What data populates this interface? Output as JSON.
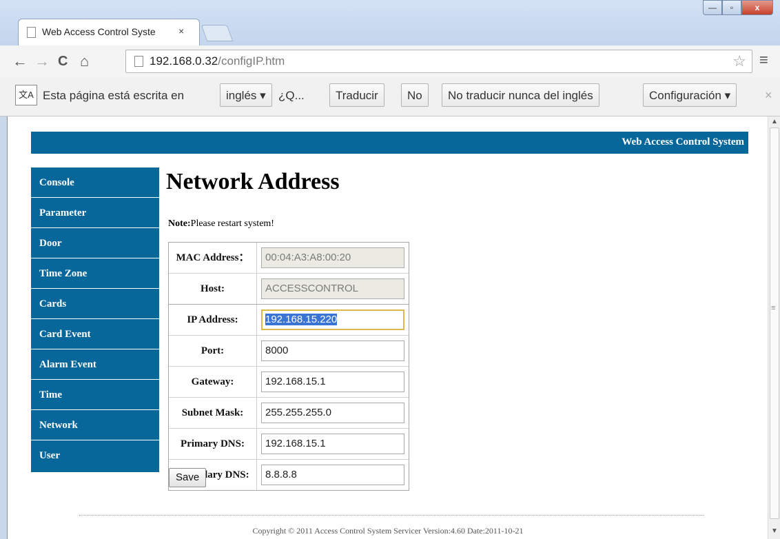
{
  "browser": {
    "tab_title": "Web Access Control Syste",
    "tab_close": "×",
    "window_controls": {
      "minimize": "—",
      "maximize": "▫",
      "close": "x"
    },
    "url_host": "192.168.0.32",
    "url_path": "/configIP.htm",
    "nav": {
      "back": "←",
      "forward": "→",
      "reload": "C",
      "home": "⌂"
    }
  },
  "translate_bar": {
    "icon_text": "文A",
    "text_prefix": "Esta página está escrita en",
    "language": "inglés ▾",
    "question": "¿Q...",
    "translate_button": "Traducir",
    "no_button": "No",
    "never_button": "No traducir nunca del inglés",
    "settings_button": "Configuración ▾",
    "close": "×"
  },
  "page": {
    "banner_title": "Web Access Control System",
    "sidebar": {
      "items": [
        {
          "label": "Console"
        },
        {
          "label": "Parameter"
        },
        {
          "label": "Door"
        },
        {
          "label": "Time Zone"
        },
        {
          "label": "Cards"
        },
        {
          "label": "Card Event"
        },
        {
          "label": "Alarm Event"
        },
        {
          "label": "Time"
        },
        {
          "label": "Network"
        },
        {
          "label": "User"
        }
      ]
    },
    "heading": "Network Address",
    "note_label": "Note:",
    "note_text": "Please restart system!",
    "form": {
      "mac_label": "MAC Address：",
      "mac_value": "00:04:A3:A8:00:20",
      "host_label": "Host:",
      "host_value": "ACCESSCONTROL",
      "ip_label": "IP Address:",
      "ip_value": "192.168.15.220",
      "port_label": "Port:",
      "port_value": "8000",
      "gateway_label": "Gateway:",
      "gateway_value": "192.168.15.1",
      "subnet_label": "Subnet Mask:",
      "subnet_value": "255.255.255.0",
      "dns1_label": "Primary DNS:",
      "dns1_value": "192.168.15.1",
      "dns2_label": "Secondary DNS:",
      "dns2_value": "8.8.8.8"
    },
    "save_label": "Save",
    "copyright": "Copyright © 2011 Access Control System Servicer Version:4.60 Date:2011-10-21"
  },
  "colors": {
    "brand_blue": "#08679a",
    "selection": "#3a75d6",
    "focus_border": "#e3b84a"
  }
}
